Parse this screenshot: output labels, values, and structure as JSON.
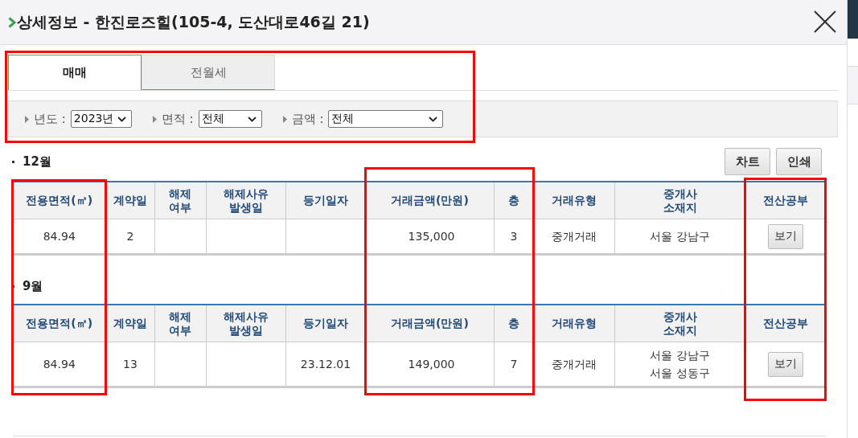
{
  "title": "상세정보 - 한진로즈힐(105-4, 도산대로46길 21)",
  "tabs": [
    {
      "label": "매매",
      "selected": true
    },
    {
      "label": "전월세",
      "selected": false
    }
  ],
  "filters": {
    "highlighted": true,
    "items": [
      {
        "label": "년도 :",
        "value": "2023년"
      },
      {
        "label": "면적 :",
        "value": "전체"
      },
      {
        "label": "금액 :",
        "value": "전체"
      }
    ]
  },
  "buttons": [
    "차트",
    "인쇄"
  ],
  "column_highlights": [
    true,
    false,
    false,
    false,
    false,
    true,
    true,
    false,
    false,
    true
  ],
  "sections": [
    {
      "heading": "12월",
      "columns": [
        "전용면적(㎡)",
        "계약일",
        "해제\n여부",
        "해제사유\n발생일",
        "등기일자",
        "거래금액(만원)",
        "층",
        "거래유형",
        "중개사\n소재지",
        "전산공부"
      ],
      "rows": [
        {
          "cells": [
            {
              "kind": "text",
              "lines": [
                "84.94"
              ]
            },
            {
              "kind": "text",
              "lines": [
                "2"
              ]
            },
            {
              "kind": "empty"
            },
            {
              "kind": "empty"
            },
            {
              "kind": "empty"
            },
            {
              "kind": "amount",
              "lines": [
                "135,000"
              ]
            },
            {
              "kind": "text",
              "lines": [
                "3"
              ]
            },
            {
              "kind": "text",
              "lines": [
                "중개거래"
              ]
            },
            {
              "kind": "text",
              "lines": [
                "서울 강남구"
              ]
            },
            {
              "kind": "button",
              "label": "보기"
            }
          ]
        }
      ]
    },
    {
      "heading": "9월",
      "columns": [
        "전용면적(㎡)",
        "계약일",
        "해제\n여부",
        "해제사유\n발생일",
        "등기일자",
        "거래금액(만원)",
        "층",
        "거래유형",
        "중개사\n소재지",
        "전산공부"
      ],
      "rows": [
        {
          "cells": [
            {
              "kind": "text",
              "lines": [
                "84.94"
              ]
            },
            {
              "kind": "text",
              "lines": [
                "13"
              ]
            },
            {
              "kind": "empty"
            },
            {
              "kind": "empty"
            },
            {
              "kind": "text",
              "lines": [
                "23.12.01"
              ]
            },
            {
              "kind": "amount",
              "lines": [
                "149,000"
              ]
            },
            {
              "kind": "text",
              "lines": [
                "7"
              ]
            },
            {
              "kind": "text",
              "lines": [
                "중개거래"
              ]
            },
            {
              "kind": "text",
              "lines": [
                "서울 강남구",
                "서울 성동구"
              ]
            },
            {
              "kind": "button",
              "label": "보기"
            }
          ]
        }
      ]
    }
  ]
}
